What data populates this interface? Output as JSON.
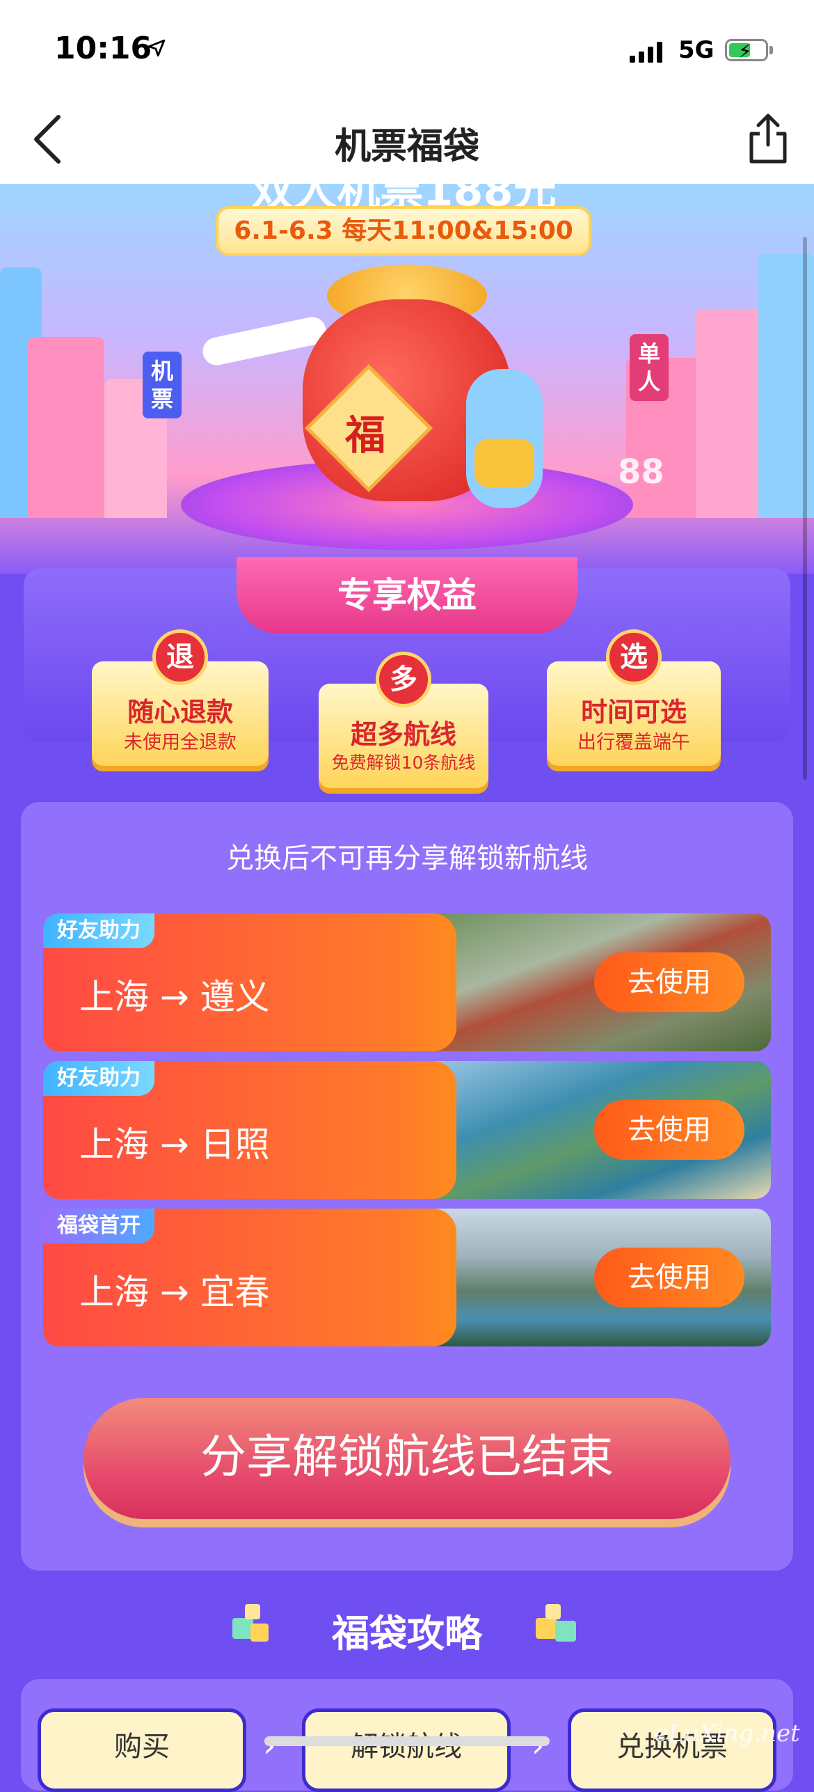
{
  "status": {
    "time": "10:16",
    "network": "5G"
  },
  "nav": {
    "title": "机票福袋"
  },
  "hero": {
    "date_pill": "6.1-6.3  每天11:00&15:00",
    "headline_partial": "双人机票188元",
    "sign_left": "机票",
    "sign_right": "单人",
    "number": "88",
    "fu": "福"
  },
  "perks": {
    "title": "专享权益",
    "items": [
      {
        "badge": "退",
        "title": "随心退款",
        "subtitle": "未使用全退款"
      },
      {
        "badge": "多",
        "title": "超多航线",
        "subtitle": "免费解锁10条航线"
      },
      {
        "badge": "选",
        "title": "时间可选",
        "subtitle": "出行覆盖端午"
      }
    ]
  },
  "routes": {
    "note": "兑换后不可再分享解锁新航线",
    "items": [
      {
        "tag": "好友助力",
        "route": "上海 → 遵义",
        "button": "去使用"
      },
      {
        "tag": "好友助力",
        "route": "上海 → 日照",
        "button": "去使用"
      },
      {
        "tag": "福袋首开",
        "route": "上海 → 宜春",
        "button": "去使用"
      }
    ]
  },
  "share_button": "分享解锁航线已结束",
  "guide": {
    "title": "福袋攻略",
    "steps": [
      "购买",
      "解锁航线",
      "兑换机票"
    ]
  },
  "watermark": "eLuXing.net",
  "colors": {
    "accent": "#6f4ef2",
    "route_gradient_start": "#ff4a44",
    "route_gradient_end": "#ff8a1e"
  }
}
